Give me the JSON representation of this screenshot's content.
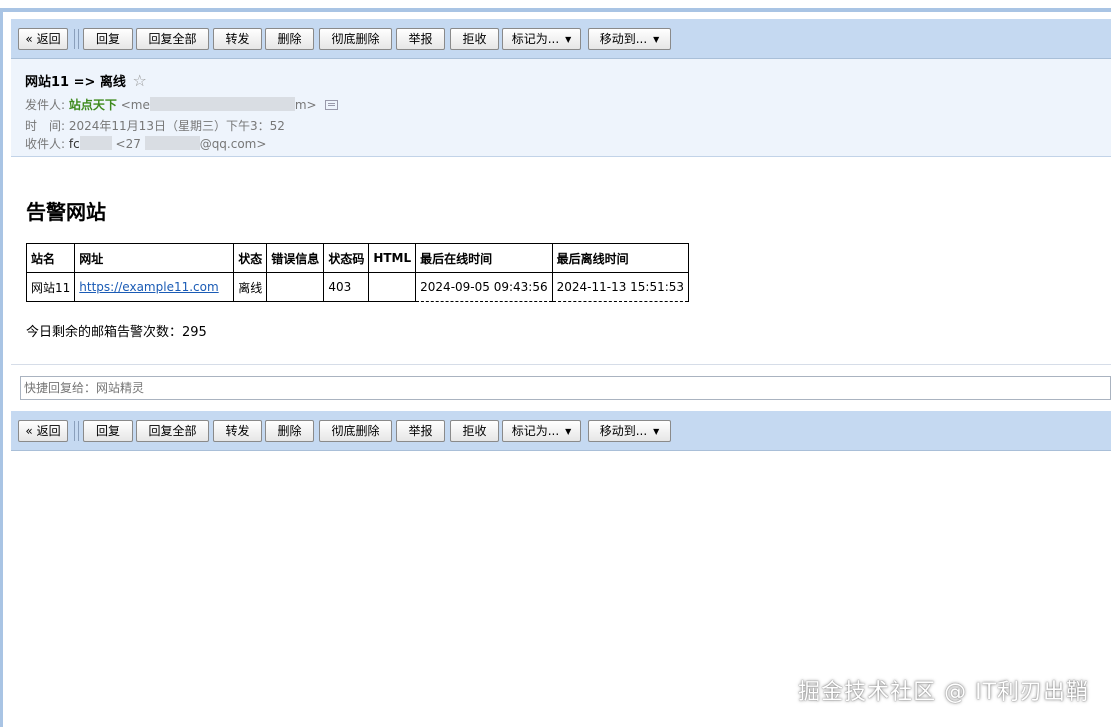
{
  "toolbar": {
    "back": "« 返回",
    "reply": "回复",
    "reply_all": "回复全部",
    "forward": "转发",
    "delete": "删除",
    "delete_permanent": "彻底删除",
    "report": "举报",
    "reject": "拒收",
    "mark_as": "标记为...",
    "move_to": "移动到..."
  },
  "mail": {
    "subject": "网站11 => 离线",
    "star_glyph": "☆",
    "from_label": "发件人:",
    "from_name": "站点天下",
    "from_email_start": "<me",
    "from_email_end": "m>",
    "time_label": "时　间:",
    "time_value": "2024年11月13日（星期三）下午3：52",
    "to_label": "收件人:",
    "to_name_start": "fc",
    "to_email_start": "<27",
    "to_email_end": "@qq.com>"
  },
  "body": {
    "title": "告警网站",
    "table": {
      "headers": [
        "站名",
        "网址",
        "状态",
        "错误信息",
        "状态码",
        "HTML",
        "最后在线时间",
        "最后离线时间"
      ],
      "row": {
        "name": "网站11",
        "url": "https://example11.com",
        "status": "离线",
        "error": "",
        "code": "403",
        "html": "",
        "last_online": "2024-09-05 09:43:56",
        "last_offline": "2024-11-13 15:51:53"
      }
    },
    "remaining": "今日剩余的邮箱告警次数：295"
  },
  "quick_reply": {
    "placeholder": "快捷回复给：网站精灵"
  },
  "watermark": "掘金技术社区 @ IT利刃出鞘"
}
